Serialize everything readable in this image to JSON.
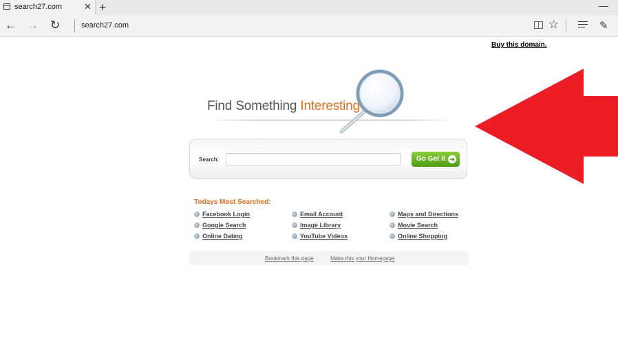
{
  "browser": {
    "tab_title": "search27.com",
    "url": "search27.com"
  },
  "page": {
    "buy_domain": "Buy this domain.",
    "headline": {
      "part1": "Find Something ",
      "part2": "Interesting"
    },
    "search": {
      "label": "Search:",
      "value": "",
      "button_label": "Go Get it"
    },
    "todays_title": "Todays Most Searched:",
    "links": [
      "Facebook Login",
      "Email Account",
      "Maps and Directions",
      "Google Search",
      "Image Library",
      "Movie Search",
      "Online Dating",
      "YouTube Videos",
      "Online Shopping"
    ],
    "footer": {
      "bookmark": "Bookmark this page",
      "homepage": "Make this your Homepage"
    }
  },
  "colors": {
    "accent_orange": "#e06e1e",
    "go_green": "#5aa81a",
    "arrow_red": "#ee1c25"
  },
  "icons": [
    "page-icon",
    "close-icon",
    "plus-icon",
    "back-arrow-icon",
    "forward-arrow-icon",
    "refresh-icon",
    "reading-view-icon",
    "star-icon",
    "hub-icon",
    "web-note-icon",
    "magnifying-glass-icon",
    "red-arrow-icon"
  ]
}
